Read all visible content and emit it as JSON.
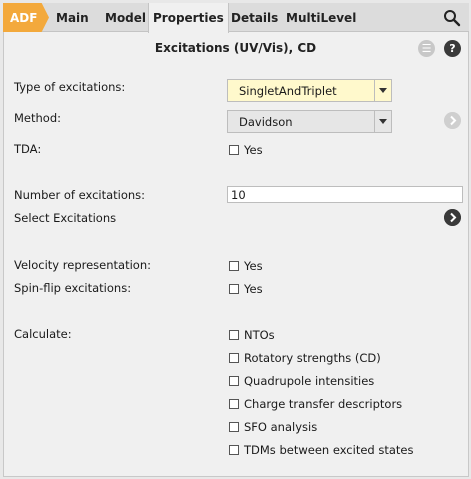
{
  "tabs": {
    "adf": "ADF",
    "main": "Main",
    "model": "Model",
    "properties": "Properties",
    "details": "Details",
    "multilevel": "MultiLevel"
  },
  "panel": {
    "title": "Excitations (UV/Vis), CD",
    "menu_glyph": "☰",
    "help_glyph": "?"
  },
  "fields": {
    "type_label": "Type of excitations:",
    "type_value": "SingletAndTriplet",
    "method_label": "Method:",
    "method_value": "Davidson",
    "tda_label": "TDA:",
    "tda_option": "Yes",
    "num_label": "Number of excitations:",
    "num_value": "10",
    "select_label": "Select Excitations",
    "velocity_label": "Velocity representation:",
    "velocity_option": "Yes",
    "spinflip_label": "Spin-flip excitations:",
    "spinflip_option": "Yes",
    "calculate_label": "Calculate:"
  },
  "calculate_options": [
    "NTOs",
    "Rotatory strengths (CD)",
    "Quadrupole intensities",
    "Charge transfer descriptors",
    "SFO analysis",
    "TDMs between excited states"
  ],
  "colors": {
    "adf_tab": "#f3a93c",
    "highlight_field": "#fff9cc"
  }
}
